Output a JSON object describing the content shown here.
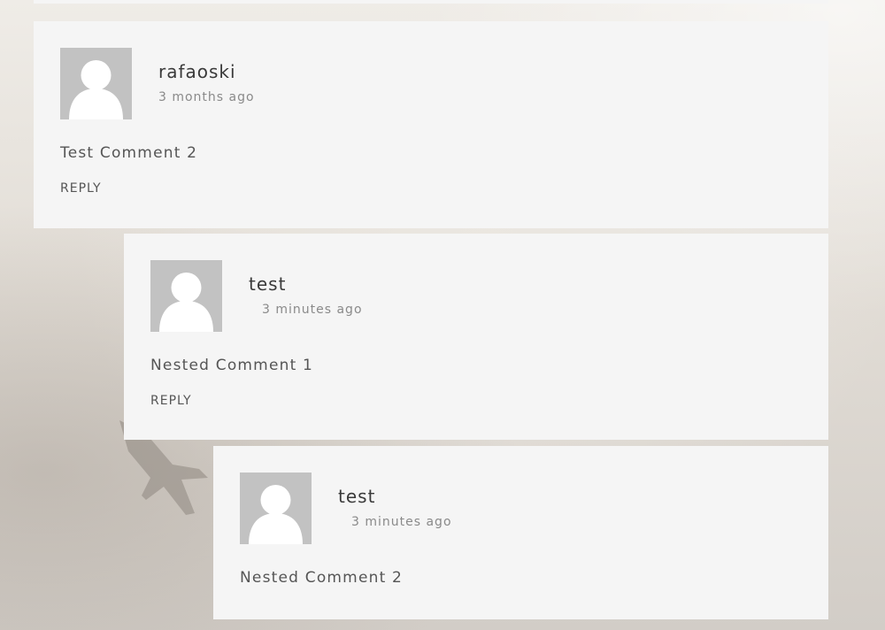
{
  "comments": [
    {
      "author": "rafaoski",
      "time": "3 months ago",
      "text": "Test Comment 2",
      "reply_label": "REPLY",
      "avatar_icon": "default-user-avatar-icon"
    },
    {
      "author": "test",
      "time": "3 minutes ago",
      "text": "Nested Comment 1",
      "reply_label": "REPLY",
      "avatar_icon": "default-user-avatar-icon"
    },
    {
      "author": "test",
      "time": "3 minutes ago",
      "text": "Nested Comment 2",
      "avatar_icon": "default-user-avatar-icon"
    }
  ],
  "colors": {
    "card_background": "#f5f5f5",
    "avatar_background": "#c2c2c2",
    "author_text": "#3a3a3a",
    "meta_text": "#8a8a8a",
    "body_text": "#555555"
  }
}
